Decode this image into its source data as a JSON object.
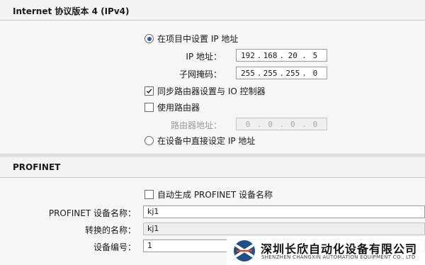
{
  "ipv4": {
    "title": "Internet 协议版本 4 (IPv4)",
    "radio_project": "在项目中设置 IP 地址",
    "ip_label": "IP 地址：",
    "ip": [
      "192",
      "168",
      "20",
      "5"
    ],
    "subnet_label": "子网掩码：",
    "subnet": [
      "255",
      "255",
      "255",
      "0"
    ],
    "sync_router": "同步路由器设置与 IO 控制器",
    "use_router": "使用路由器",
    "router_label": "路由器地址：",
    "router": [
      "0",
      "0",
      "0",
      "0"
    ],
    "radio_device": "在设备中直接设定 IP 地址"
  },
  "profinet": {
    "title": "PROFINET",
    "auto_generate": "自动生成 PROFINET 设备名称",
    "device_name_label": "PROFINET 设备名称：",
    "device_name": "kj1",
    "converted_label": "转换的名称：",
    "converted_name": "kj1",
    "device_number_label": "设备编号：",
    "device_number": "1"
  },
  "watermark": {
    "cn": "深圳长欣自动化设备有限公司",
    "en": "SHENZHEN CHANGXIN AUTOMATION EQUIPMENT CO., LTD"
  },
  "colors": {
    "radio_selected": "#2a5fb0",
    "checkbox_check": "#1a1a1a"
  }
}
